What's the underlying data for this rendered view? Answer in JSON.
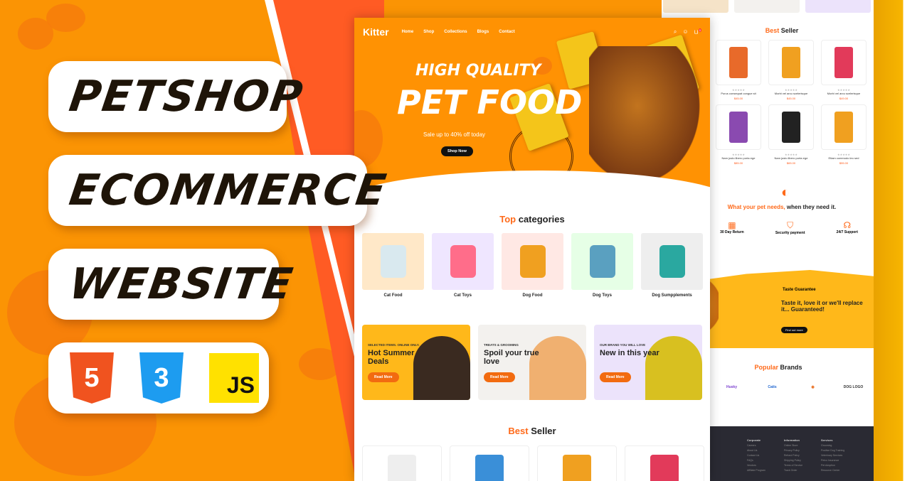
{
  "banner": {
    "lines": [
      "PETSHOP",
      "ECOMMERCE",
      "WEBSITE"
    ],
    "tech": {
      "html": "5",
      "css": "3",
      "js": "JS"
    }
  },
  "colors": {
    "brand_orange": "#ff9203",
    "accent": "#ff6a1a",
    "background": "#fb9404",
    "stripe": "#ff5b24"
  },
  "site": {
    "logo": "Kitter",
    "nav": [
      "Home",
      "Shop",
      "Collections",
      "Blogs",
      "Contact"
    ],
    "cart_count": "0",
    "hero": {
      "line1": "HIGH QUALITY",
      "line2": "PET FOOD",
      "subtitle": "Sale up to 40% off today",
      "cta": "Shop Now"
    },
    "categories": {
      "title_accent": "Top",
      "title_rest": "categories",
      "items": [
        "Cat Food",
        "Cat Toys",
        "Dog Food",
        "Dog Toys",
        "Dog Sumpplements"
      ]
    },
    "promos": [
      {
        "eyebrow": "SELECTED ITEMS. ONLINE ONLY.",
        "title": "Hot Summer Deals",
        "cta": "Read More"
      },
      {
        "eyebrow": "TREATS & GROOMING",
        "title": "Spoil your true love",
        "cta": "Read More"
      },
      {
        "eyebrow": "OUR BRAND YOU WILL LOVE",
        "title": "New in this year",
        "cta": "Read More"
      }
    ],
    "best_seller": {
      "title_accent": "Best",
      "title_rest": "Seller"
    }
  },
  "side_page": {
    "best_seller": {
      "title_accent": "Best",
      "title_rest": "Seller",
      "products": [
        {
          "name": "Purus consequat congue sit",
          "price": "$45.00"
        },
        {
          "name": "Morbi vel arcu scelerisque",
          "price": "$45.00"
        },
        {
          "name": "Morbi vel arcu scelerisque",
          "price": "$49.00"
        },
        {
          "name": "Nam justo libero porta ege",
          "price": "$85.00"
        },
        {
          "name": "Nam justo libero porta ege",
          "price": "$65.00"
        },
        {
          "name": "Etiam commodo leo sed",
          "price": "$55.00"
        }
      ]
    },
    "needs": {
      "accent": "What your pet needs,",
      "rest": "when they need it."
    },
    "features": [
      "30 Day Return",
      "Security payment",
      "24/7 Support"
    ],
    "guarantee": {
      "badge": "Taste Guarantee",
      "title": "Taste it, love it or we'll replace it... Guaranteed!",
      "cta": "Find out more"
    },
    "brands": {
      "title_accent": "Popular",
      "title_rest": "Brands",
      "items": [
        "Husky",
        "Catis",
        "DOG LOGO"
      ]
    },
    "footer": {
      "columns": [
        {
          "title": "Corporate",
          "links": [
            "Careers",
            "About Us",
            "Contact Us",
            "FAQs",
            "Vendors",
            "Affiliate Program"
          ]
        },
        {
          "title": "Information",
          "links": [
            "Online Store",
            "Privacy Policy",
            "Refund Policy",
            "Shipping Policy",
            "Terms of Service",
            "Track Order"
          ]
        },
        {
          "title": "Services",
          "links": [
            "Grooming",
            "Positive Dog Training",
            "Veterinary Services",
            "Petco Insurance",
            "Pet Adoption",
            "Resource Center"
          ]
        }
      ]
    }
  }
}
